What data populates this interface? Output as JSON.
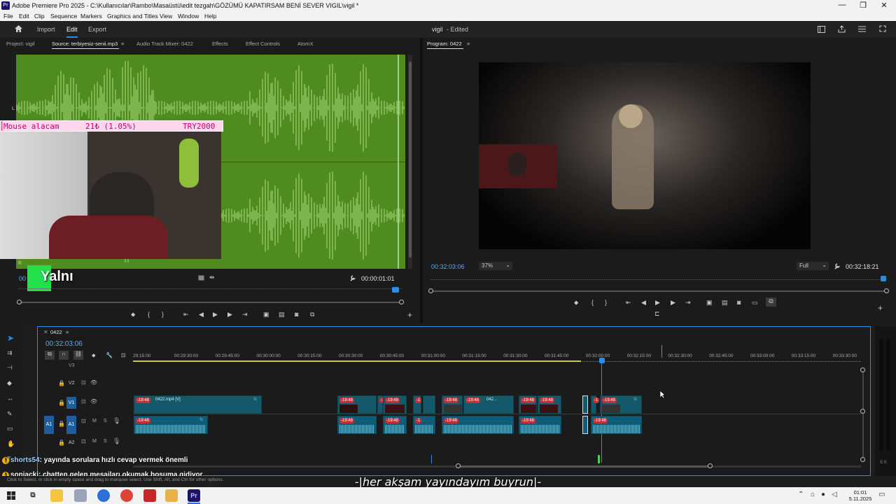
{
  "titlebar": {
    "title": "Adobe Premiere Pro 2025 - C:\\Kullanıcılar\\Rambo\\Masaüstü\\edit tezgah\\GÖZÜMÜ KAPATIRSAM BENİ SEVER VIGIL\\vigil *",
    "app_icon": "Pr",
    "minimize": "—",
    "restore": "❐",
    "close": "✕"
  },
  "menu": [
    "File",
    "Edit",
    "Clip",
    "Sequence",
    "Markers",
    "Graphics and Titles",
    "View",
    "Window",
    "Help"
  ],
  "appbar": {
    "workspaces": [
      "Import",
      "Edit",
      "Export"
    ],
    "active_workspace": "Edit",
    "project_title": "vigil",
    "project_status": "- Edited"
  },
  "source_panel": {
    "tabs": [
      "Project: vigil",
      "Source: terbiyesiz-senii.mp3",
      "Audio Track Mixer: 0422",
      "Effects",
      "Effect Controls",
      "AtomX"
    ],
    "active_tab": "Source: terbiyesiz-senii.mp3",
    "menu_icon": "≡",
    "timecode_left": "00",
    "timecode_right": "00:00:01:01",
    "channel_left": "L",
    "channel_right": "R",
    "overlay_text": "Yalnı",
    "waveform_color": "#4f8b1e"
  },
  "donation_bar": {
    "left": "Mouse alacam",
    "middle": "21₺ (1.05%)",
    "right": "TRY2000",
    "progress_pct": 1.05
  },
  "program_panel": {
    "tab": "Program: 0422",
    "menu_icon": "≡",
    "timecode": "00:32:03:06",
    "zoom": "37%",
    "resolution": "Full",
    "duration": "00:32:18:21"
  },
  "timeline": {
    "sequence_name": "0422",
    "menu_icon": "≡",
    "close_icon": "✕",
    "playhead_timecode": "00:32:03:06",
    "ruler": [
      "29:15:00",
      "00:29:30:00",
      "00:29:45:00",
      "00:30:00:00",
      "00:30:15:00",
      "00:30:30:00",
      "00:30:45:00",
      "00:31:00:00",
      "00:31:15:00",
      "00:31:30:00",
      "00:31:45:00",
      "00:32:00:00",
      "00:32:15:00",
      "00:32:30:00",
      "00:32:45:00",
      "00:33:00:00",
      "00:33:15:00",
      "00:33:30:00"
    ],
    "tracks": {
      "v3": "V3",
      "v2": "V2",
      "v1": "V1",
      "a1": "A1",
      "a2": "A2",
      "source_v": "V1",
      "source_a": "A1",
      "mute": "M",
      "solo": "S"
    },
    "clip_badge": "-19:48",
    "clip_badge_short": "-1",
    "clip_v1_name": "0422.mp4 [V]",
    "clip_short_name": "042...",
    "fx": "fx",
    "colors": {
      "video_clip": "#13596a",
      "audio_clip": "#0f5c78",
      "playhead": "#2d8ceb"
    }
  },
  "chat": [
    {
      "user": "shorts54",
      "message": ": yayında sorulara hızlı cevap vermek önemli"
    },
    {
      "user": "sonjacki",
      "message": ": chatten gelen mesajları okumak hoşuma gidiyor"
    }
  ],
  "status_hint": "Click to Select, or click in empty space and drag to marquee select. Use Shift, Alt, and Ctrl for other options.",
  "subtitle": "-|her akşam yayındayım buyrun|-",
  "taskbar": {
    "time": "01:01",
    "date": "5.11.2025",
    "pr_icon": "Pr"
  }
}
